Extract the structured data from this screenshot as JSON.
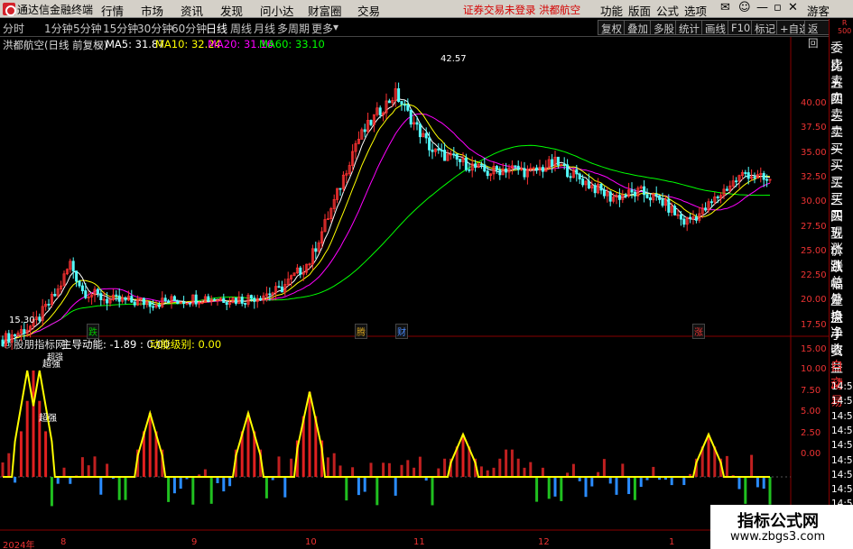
{
  "menubar": {
    "app_title": "通达信金融终端",
    "items": [
      "行情",
      "市场",
      "资讯",
      "发现",
      "问小达",
      "财富圈",
      "交易"
    ],
    "notice": "证券交易未登录  洪都航空",
    "right_items": [
      "功能",
      "版面",
      "公式",
      "选项"
    ],
    "guest": "游客"
  },
  "toolbar": {
    "periods": [
      "分时",
      "1分钟",
      "5分钟",
      "15分钟",
      "30分钟",
      "60分钟",
      "日线",
      "周线",
      "月线",
      "多周期",
      "更多"
    ],
    "active_period": "日线",
    "right_buttons": [
      "复权",
      "叠加",
      "多股",
      "统计",
      "画线",
      "F10",
      "标记",
      "+自选",
      "返回"
    ]
  },
  "main_info": {
    "stock": "洪都航空(日线 前复权)",
    "ma5": "MA5: 31.87",
    "ma10": "MA10: 32.24",
    "ma20": "MA20: 31.16",
    "ma60": "MA60: 33.10",
    "colors": {
      "ma5": "#ffffff",
      "ma10": "#ffff00",
      "ma20": "#ff00ff",
      "ma60": "#00ff00"
    }
  },
  "price_axis": [
    "40.00",
    "37.50",
    "35.00",
    "32.50",
    "30.00",
    "27.50",
    "25.00",
    "22.50",
    "20.00",
    "17.50",
    "15.00"
  ],
  "annotations": {
    "high": "42.57",
    "low": "15.30"
  },
  "event_markers": [
    {
      "text": "跌",
      "color": "#00c000"
    },
    {
      "text": "腾",
      "color": "#d0a020"
    },
    {
      "text": "财",
      "color": "#4a8cff"
    },
    {
      "text": "涨",
      "color": "#e33333"
    }
  ],
  "indicator_info": {
    "name": "股朋指标网",
    "line1": "主导动能: -1.89 : 0.00",
    "line2": "动能级别: 0.00",
    "labels": [
      "超强",
      "超强",
      "超强"
    ]
  },
  "indicator_axis": [
    "10.00",
    "7.50",
    "5.00",
    "2.50",
    "0.00"
  ],
  "date_axis": [
    "2024年",
    "8",
    "9",
    "10",
    "11",
    "12",
    "1"
  ],
  "side_column": {
    "items": [
      "委比",
      "卖五",
      "卖四",
      "卖三",
      "卖二",
      "卖一",
      "买一",
      "买二",
      "买三",
      "买四",
      "买五",
      "现价",
      "涨跌",
      "涨幅",
      "总量",
      "外盘",
      "换手",
      "净资",
      "收益",
      "自动",
      "交易"
    ],
    "times": [
      "14:56",
      "14:56",
      "14:56",
      "14:56",
      "14:56",
      "14:56",
      "14:56",
      "14:56",
      "14:56",
      "14:56"
    ],
    "r_label": "R",
    "r_value": "500"
  },
  "watermark": {
    "line1": "指标公式网",
    "line2": "www.zbgs3.com"
  }
}
